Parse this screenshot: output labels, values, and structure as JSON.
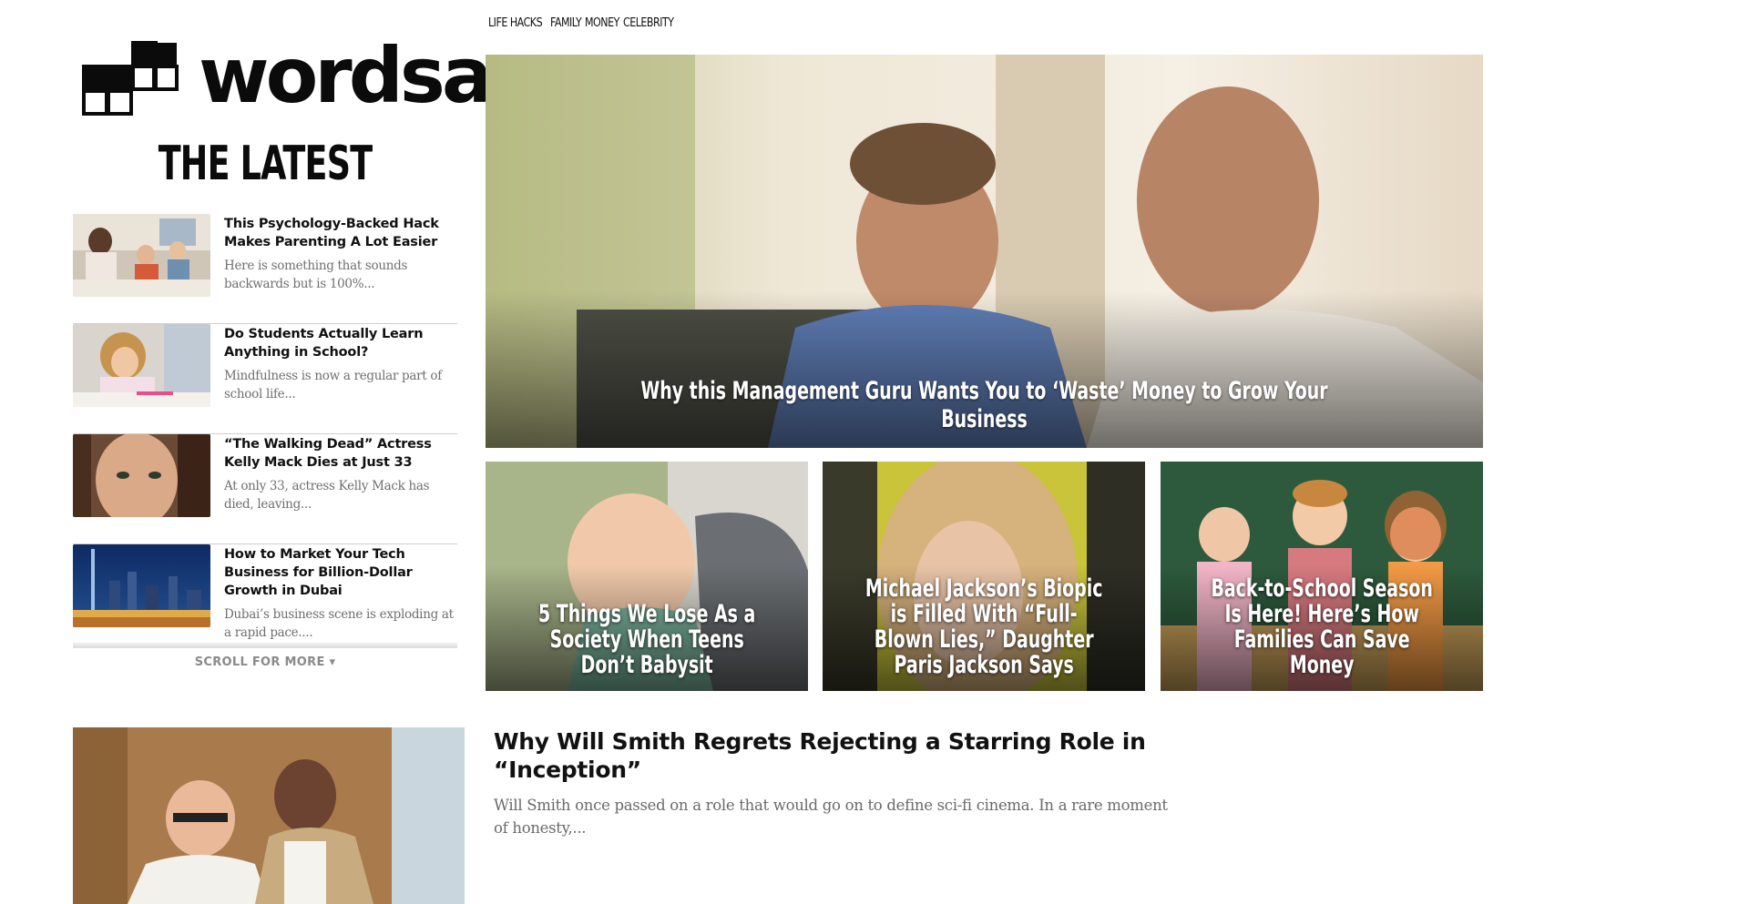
{
  "nav": {
    "items": [
      "LIFE HACKS",
      "FAMILY",
      "MONEY",
      "CELEBRITY"
    ]
  },
  "logo": {
    "text": "wordsa"
  },
  "latest": {
    "heading": "THE LATEST",
    "items": [
      {
        "title": "This Psychology-Backed Hack Makes Parenting A Lot Easier",
        "excerpt": "Here is something that sounds backwards but is 100%..."
      },
      {
        "title": "Do Students Actually Learn Anything in School?",
        "excerpt": "Mindfulness is now a regular part of school life..."
      },
      {
        "title": "“The Walking Dead” Actress Kelly Mack Dies at Just 33",
        "excerpt": "At only 33, actress Kelly Mack has died, leaving..."
      },
      {
        "title": "How to Market Your Tech Business for Billion-Dollar Growth in Dubai",
        "excerpt": "Dubai’s business scene is exploding at a rapid pace...."
      }
    ],
    "scroll_more": "SCROLL FOR MORE ▾"
  },
  "hero": {
    "title": "Why this Management Guru Wants You to ‘Waste’ Money to Grow Your Business"
  },
  "cards": [
    {
      "title": "5 Things We Lose As a Society When Teens Don’t Babysit"
    },
    {
      "title": "Michael Jackson’s Biopic is Filled With “Full-Blown Lies,” Daughter Paris Jackson Says"
    },
    {
      "title": "Back-to-School Season Is Here! Here’s How Families Can Save Money"
    }
  ],
  "bottom_article": {
    "title": "Why Will Smith Regrets Rejecting a Starring Role in “Inception”",
    "excerpt": "Will Smith once passed on a role that would go on to define sci-fi cinema. In a rare moment of honesty,..."
  }
}
